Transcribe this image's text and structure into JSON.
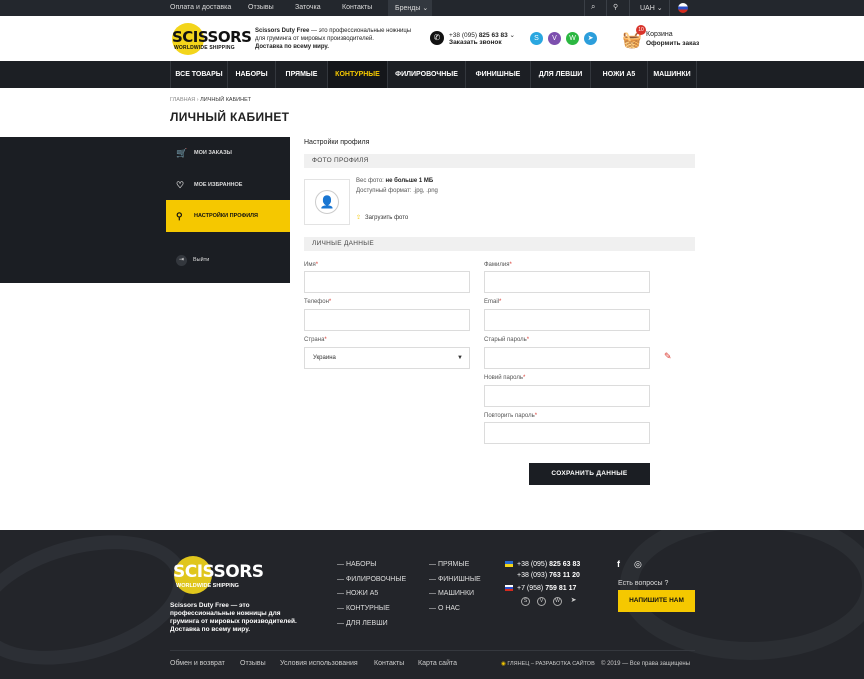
{
  "topbar": {
    "links": [
      "Оплата и доставка",
      "Отзывы",
      "Заточка",
      "Контакты"
    ],
    "brands": "Бренды",
    "currency": "UAH"
  },
  "header": {
    "logo_word": "SCISSORS",
    "logo_sub": "WORLDWIDE SHIPPING",
    "tagline_bold": "Scissors Duty Free",
    "tagline_rest": " — это профессиональные ножницы для груминга от мировых производителей.",
    "tagline_bold2": "Доставка по всему миру.",
    "phone_prefix": "+38 (095) ",
    "phone_main": "825 63 83",
    "call_label": "Заказать звонок",
    "cart_count": "10",
    "cart_label": "Корзина",
    "cart_order": "Оформить заказ"
  },
  "nav": {
    "items": [
      "ВСЕ ТОВАРЫ",
      "НАБОРЫ",
      "ПРЯМЫЕ",
      "КОНТУРНЫЕ",
      "ФИЛИРОВОЧНЫЕ",
      "ФИНИШНЫЕ",
      "ДЛЯ ЛЕВШИ",
      "НОЖИ А5",
      "МАШИНКИ"
    ],
    "active_index": 3
  },
  "breadcrumb": {
    "home": "ГЛАВНАЯ",
    "current": "ЛИЧНЫЙ КАБИНЕТ"
  },
  "page_title": "ЛИЧНЫЙ КАБИНЕТ",
  "sidebar": {
    "items": [
      "МОИ ЗАКАЗЫ",
      "МОЕ ИЗБРАННОЕ",
      "НАСТРОЙКИ ПРОФИЛЯ"
    ],
    "active_index": 2,
    "exit": "Выйти"
  },
  "profile": {
    "title": "Настройки профиля",
    "photo_section": "ФОТО ПРОФИЛЯ",
    "size_label": "Вес фото: ",
    "size_value": "не больше 1 МБ",
    "format_label": "Доступный формат: ",
    "format_value": ".jpg, .png",
    "upload": "Загрузить фото",
    "personal_section": "ЛИЧНЫЕ ДАННЫЕ",
    "fields": {
      "name": "Имя",
      "surname": "Фамилия",
      "phone": "Телефон",
      "email": "Email",
      "country": "Страна",
      "country_value": "Украина",
      "old_password": "Старый пароль",
      "new_password": "Новий пароль",
      "repeat_password": "Повторить пароль"
    },
    "save": "СОХРАНИТЬ ДАННЫЕ"
  },
  "footer": {
    "logo_word": "SCISSORS",
    "logo_sub": "WORLDWIDE SHIPPING",
    "desc": "Scissors Duty Free — это профессиональные ножницы для груминга от мировых производителей. Доставка по всему миру.",
    "col1": [
      "— НАБОРЫ",
      "— ФИЛИРОВОЧНЫЕ",
      "— НОЖИ А5",
      "— КОНТУРНЫЕ",
      "— ДЛЯ ЛЕВШИ"
    ],
    "col2": [
      "— ПРЯМЫЕ",
      "— ФИНИШНЫЕ",
      "— МАШИНКИ",
      "— О НАС"
    ],
    "phones": [
      {
        "prefix": "+38 (095) ",
        "num": "825 63 83"
      },
      {
        "prefix": "+38 (093) ",
        "num": "763 11 20"
      },
      {
        "prefix": "+7 (958) ",
        "num": "759 81 17"
      }
    ],
    "question": "Есть вопросы ?",
    "ask": "НАПИШИТЕ НАМ",
    "bottom_links": [
      "Обмен и возврат",
      "Отзывы",
      "Условия использования",
      "Контакты",
      "Карта сайта"
    ],
    "dev": "ГЛЯНЕЦ – РАЗРАБОТКА САЙТОВ",
    "copyright": "2019 — Все права защищены"
  },
  "colors": {
    "accent": "#f5c800",
    "dark": "#1b1e23"
  }
}
